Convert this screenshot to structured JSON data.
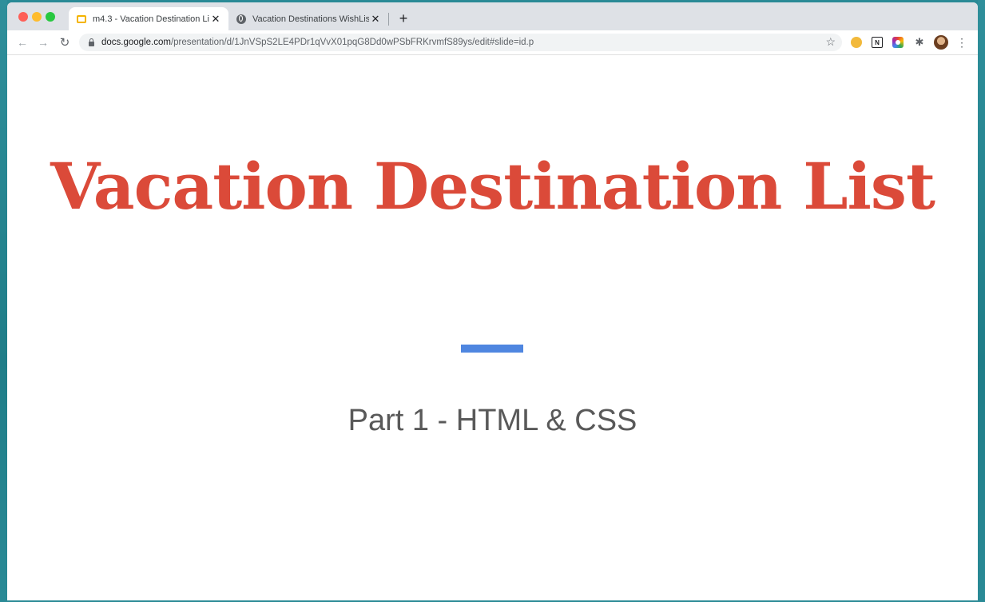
{
  "browser": {
    "tabs": [
      {
        "title": "m4.3 - Vacation Destination Li",
        "icon": "slides-icon",
        "active": true
      },
      {
        "title": "Vacation Destinations WishList",
        "icon": "globe-icon",
        "active": false
      }
    ],
    "tab_close_glyph": "✕",
    "new_tab_glyph": "+",
    "url_host": "docs.google.com",
    "url_path": "/presentation/d/1JnVSpS2LE4PDr1qVvX01pqG8Dd0wPSbFRKrvmfS89ys/edit#slide=id.p",
    "extensions": [
      "coin-extension-icon",
      "notion-extension-icon",
      "colorpicker-extension-icon",
      "puzzle-extensions-icon"
    ],
    "notion_glyph": "N"
  },
  "slide": {
    "title": "Vacation Destination List",
    "subtitle": "Part 1 - HTML & CSS",
    "title_color": "#db4a39",
    "accent_color": "#4f86e0",
    "subtitle_color": "#595959"
  }
}
